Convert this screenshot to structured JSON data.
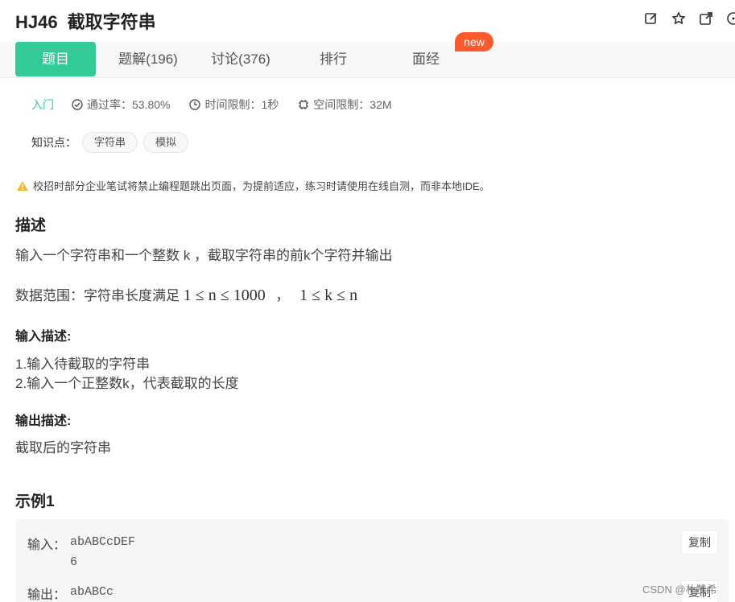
{
  "header": {
    "code": "HJ46",
    "title": "截取字符串",
    "icons": [
      "edit-icon",
      "star-icon",
      "external-link-icon",
      "more-icon"
    ]
  },
  "tabs": [
    {
      "label": "题目",
      "active": true
    },
    {
      "label": "题解(196)"
    },
    {
      "label": "讨论(376)"
    },
    {
      "label": "排行"
    },
    {
      "label": "面经"
    }
  ],
  "new_badge": "new",
  "meta": {
    "level": "入门",
    "pass_rate": "通过率：53.80%",
    "time_limit": "时间限制：1秒",
    "space_limit": "空间限制：32M"
  },
  "knowledge": {
    "label": "知识点：",
    "tags": [
      "字符串",
      "模拟"
    ]
  },
  "notice": "校招时部分企业笔试将禁止编程题跳出页面，为提前适应，练习时请使用在线自测，而非本地IDE。",
  "description": {
    "heading": "描述",
    "text": "输入一个字符串和一个整数 k ，截取字符串的前k个字符并输出",
    "range_prefix": "数据范围：字符串长度满足",
    "range_math1": "1 ≤ n ≤ 1000",
    "range_sep": "，",
    "range_math2": "1 ≤ k ≤ n"
  },
  "input_desc": {
    "heading": "输入描述:",
    "lines": [
      "1.输入待截取的字符串",
      "2.输入一个正整数k，代表截取的长度"
    ]
  },
  "output_desc": {
    "heading": "输出描述:",
    "text": "截取后的字符串"
  },
  "example": {
    "heading": "示例1",
    "input_label": "输入：",
    "input_lines": [
      "abABCcDEF",
      "6"
    ],
    "output_label": "输出：",
    "output_value": "abABCc",
    "copy_label": "复制"
  },
  "watermark": "CSDN @朴赞希",
  "colors": {
    "accent": "#32ca99",
    "badge": "#fa5a2c"
  }
}
